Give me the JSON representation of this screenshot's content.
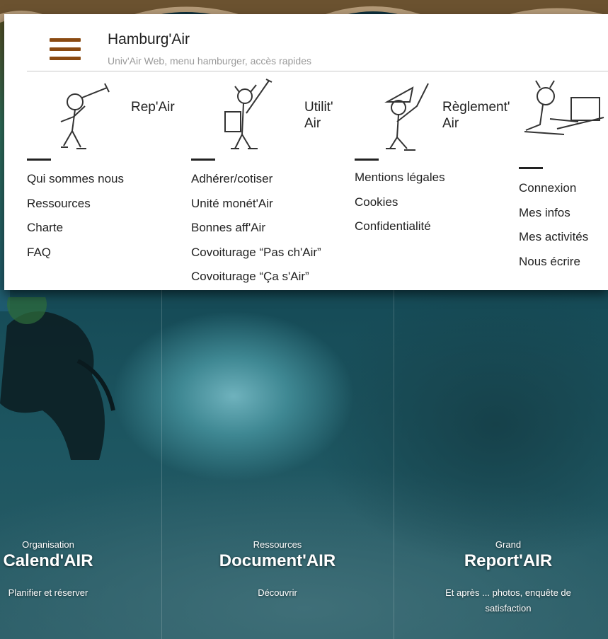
{
  "header": {
    "title": "Hamburg'Air",
    "subtitle": "Univ'Air Web, menu hamburger, accès rapides"
  },
  "menu": {
    "categories": [
      {
        "name": "Rep'Air",
        "illustration": "mole-with-telescope",
        "links": [
          "Qui sommes nous",
          "Ressources",
          "Charte",
          "FAQ"
        ]
      },
      {
        "name": "Utilit' Air",
        "illustration": "mole-with-backpack-and-stick",
        "links": [
          "Adhérer/cotiser",
          "Unité monét'Air",
          "Bonnes aff'Air",
          "Covoiturage “Pas ch'Air”",
          "Covoiturage “Ça s'Air”"
        ]
      },
      {
        "name": "Règlement' Air",
        "illustration": "mole-with-hat-and-stick",
        "links": [
          "Mentions légales",
          "Cookies",
          "Confidentialité"
        ]
      },
      {
        "name": "",
        "illustration": "mole-at-computer",
        "links": [
          "Connexion",
          "Mes infos",
          "Mes activités",
          "Nous écrire"
        ]
      }
    ]
  },
  "columns": [
    {
      "pre": "Organisation",
      "title": "Calend'AIR",
      "link": "Planifier et réserver"
    },
    {
      "pre": "Ressources",
      "title": "Document'AIR",
      "link": "Découvrir"
    },
    {
      "pre": "Grand",
      "title": "Report'AIR",
      "link": "Et après ... photos, enquête de satisfaction"
    }
  ],
  "colors": {
    "hamburger": "#8a4a12",
    "wave_dark": "#6b5230",
    "wave_light": "#b49a78",
    "panel_bg": "#ffffff"
  }
}
